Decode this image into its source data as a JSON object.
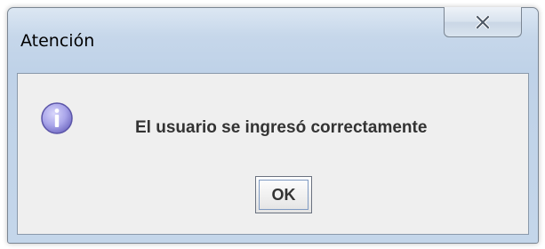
{
  "dialog": {
    "title": "Atención",
    "message": "El usuario se ingresó correctamente",
    "icon": "information-icon",
    "buttons": {
      "ok_label": "OK",
      "close_icon": "close-x-icon"
    }
  },
  "colors": {
    "frame": "#c6d7ea",
    "client_background": "#efefef",
    "message_text": "#333333",
    "icon_fill": "#a9a6e6"
  }
}
